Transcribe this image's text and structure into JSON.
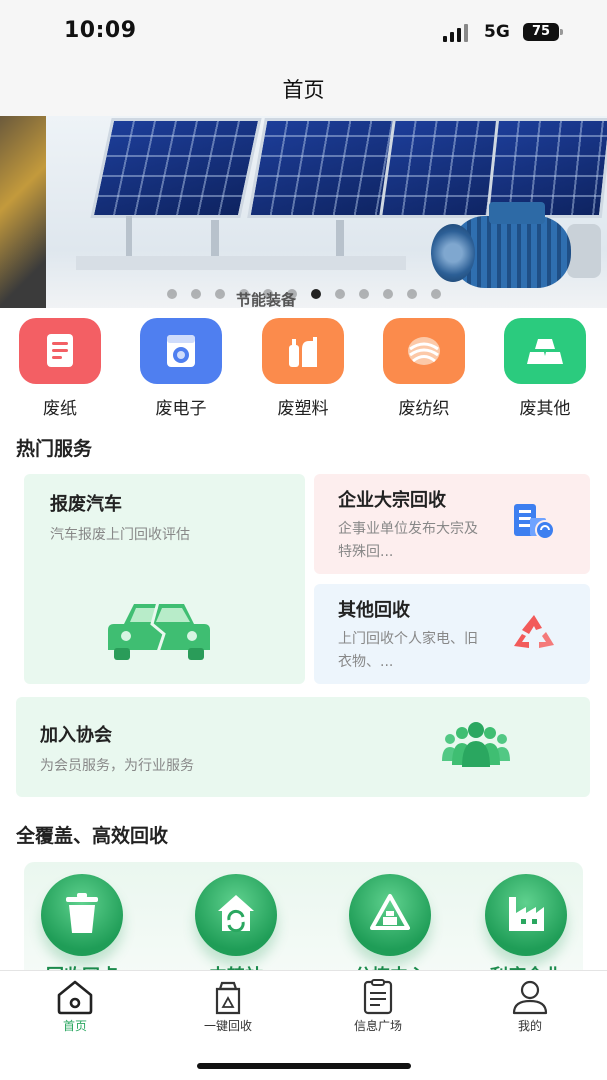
{
  "status_bar": {
    "time": "10:09",
    "network": "5G",
    "battery": "75"
  },
  "nav": {
    "title": "首页"
  },
  "banner": {
    "caption": "节能装备",
    "active_dot": 7,
    "dot_count": 12
  },
  "categories": [
    {
      "label": "废纸",
      "icon": "paper-doc-icon",
      "color": "#f35f64"
    },
    {
      "label": "废电子",
      "icon": "washing-machine-icon",
      "color": "#4f7ff0"
    },
    {
      "label": "废塑料",
      "icon": "plastic-bottles-icon",
      "color": "#fb8b4c"
    },
    {
      "label": "废纺织",
      "icon": "textile-roll-icon",
      "color": "#fb8b4c"
    },
    {
      "label": "废其他",
      "icon": "gold-bars-icon",
      "color": "#2bcb7e"
    }
  ],
  "hot_services": {
    "heading": "热门服务",
    "car_scrap": {
      "title": "报废汽车",
      "desc": "汽车报废上门回收评估",
      "icon": "broken-car-icon"
    },
    "enterprise": {
      "title": "企业大宗回收",
      "desc": "企事业单位发布大宗及特殊回...",
      "icon": "building-recycle-icon"
    },
    "other": {
      "title": "其他回收",
      "desc": "上门回收个人家电、旧衣物、...",
      "icon": "recycle-icon"
    },
    "association": {
      "title": "加入协会",
      "desc": "为会员服务，为行业服务",
      "icon": "people-group-icon"
    }
  },
  "coverage": {
    "heading": "全覆盖、高效回收",
    "items": [
      {
        "label": "回收网点",
        "icon": "trash-bin-icon"
      },
      {
        "label": "中转站",
        "icon": "transfer-house-icon"
      },
      {
        "label": "分拣中心",
        "icon": "sorting-recycle-icon"
      },
      {
        "label": "利废企业",
        "icon": "factory-icon"
      }
    ]
  },
  "tabs": [
    {
      "label": "首页",
      "icon": "home-icon",
      "active": true
    },
    {
      "label": "一键回收",
      "icon": "recycle-box-icon",
      "active": false
    },
    {
      "label": "信息广场",
      "icon": "document-icon",
      "active": false
    },
    {
      "label": "我的",
      "icon": "user-icon",
      "active": false
    }
  ],
  "colors": {
    "primary": "#2aa760",
    "card_green": "#e9f8ef",
    "card_pink": "#fdeeee",
    "card_blue": "#edf5fc"
  }
}
